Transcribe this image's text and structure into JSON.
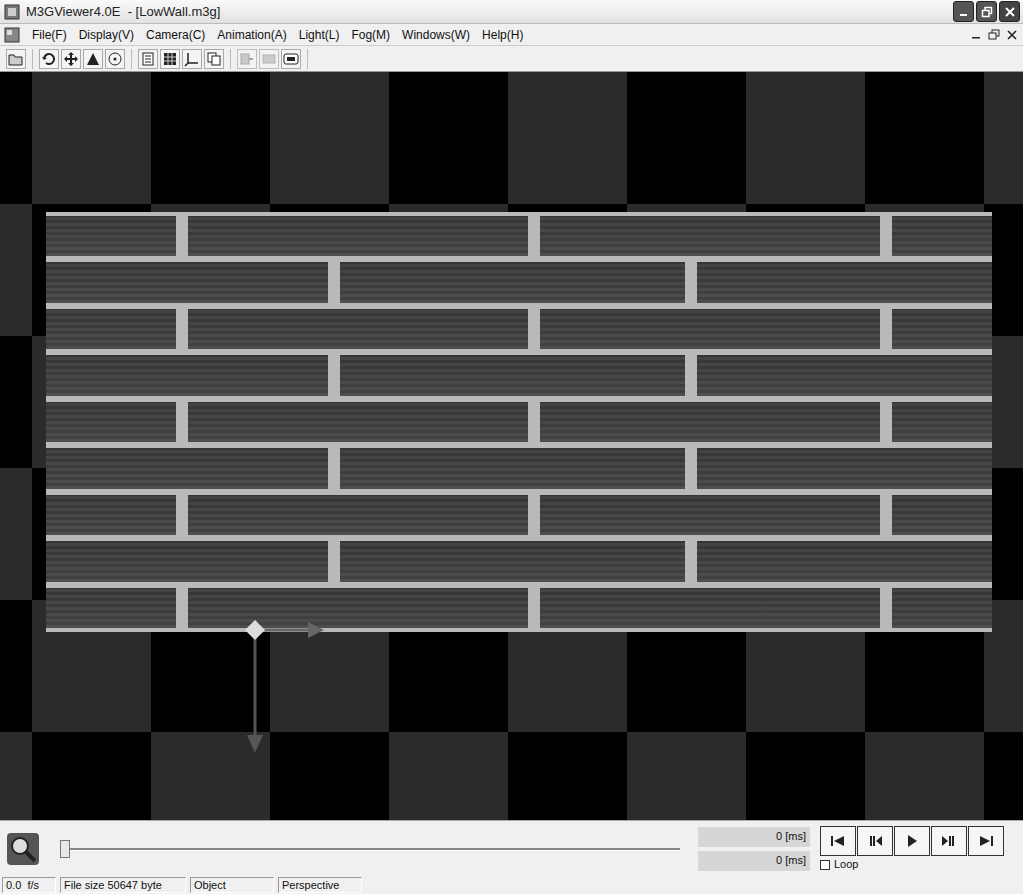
{
  "window": {
    "title": "M3GViewer4.0E  - [LowWall.m3g]"
  },
  "menu": [
    "File(F)",
    "Display(V)",
    "Camera(C)",
    "Animation(A)",
    "Light(L)",
    "Fog(M)",
    "Windows(W)",
    "Help(H)"
  ],
  "timeline": {
    "level": 0,
    "readings": [
      "0 [ms]",
      "0 [ms]"
    ],
    "loop": {
      "label": "Loop",
      "checked": false
    }
  },
  "status_bar": [
    "0.0  f/s",
    "File size 50647 byte",
    "Object",
    "Perspective"
  ]
}
